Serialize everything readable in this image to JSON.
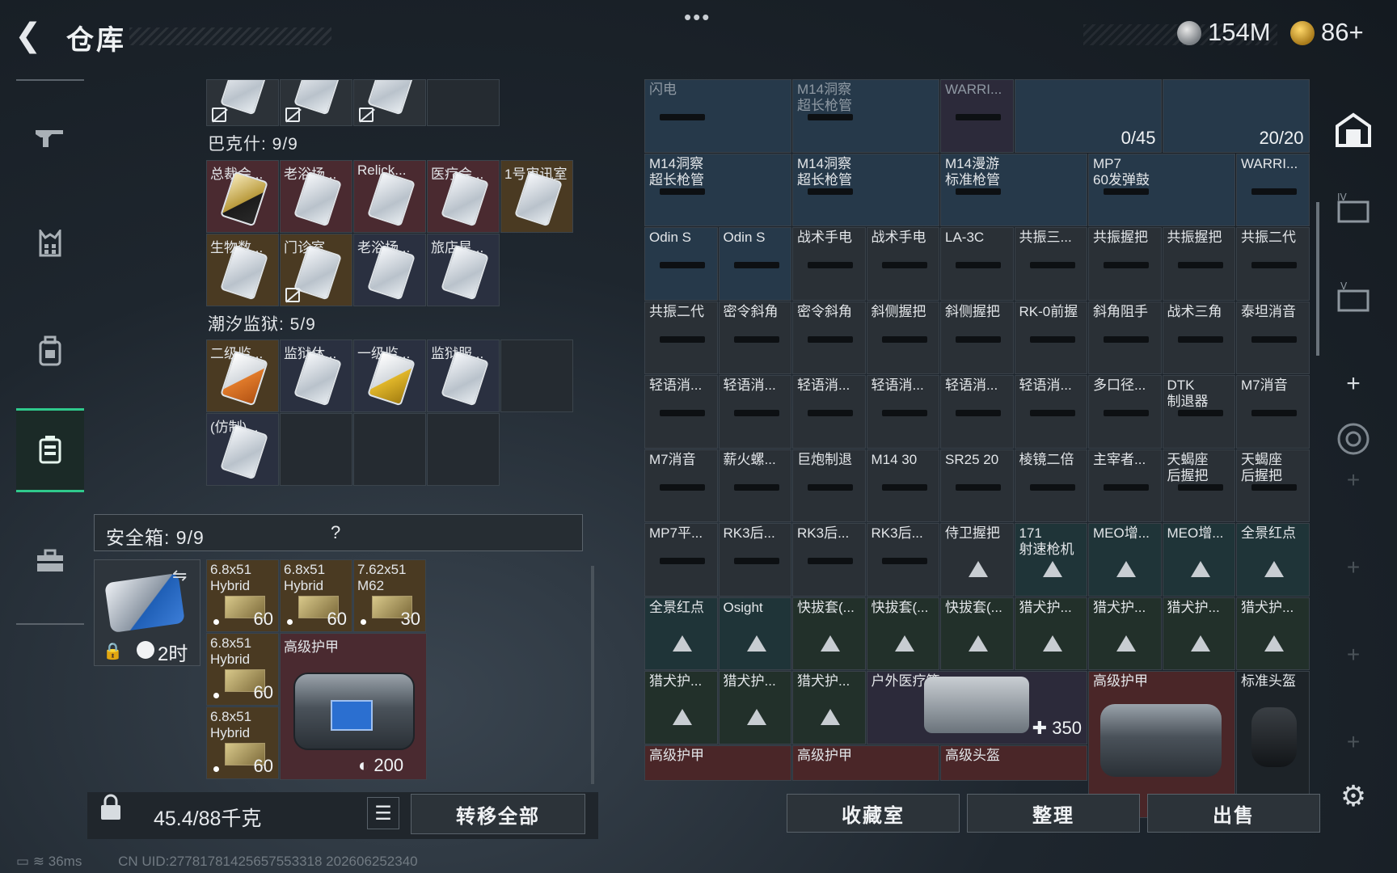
{
  "header": {
    "title": "仓库",
    "more": "•••",
    "currency_silver": "154M",
    "currency_gold": "86+"
  },
  "left": {
    "section_baker": "巴克什: 9/9",
    "section_tide": "潮汐监狱: 5/9",
    "baker_items": [
      {
        "label": "总裁会..."
      },
      {
        "label": "老浴场..."
      },
      {
        "label": "Relick..."
      },
      {
        "label": "医疗会..."
      },
      {
        "label": "1号审讯室"
      },
      {
        "label": "生物数..."
      },
      {
        "label": "门诊室"
      },
      {
        "label": "老浴场..."
      },
      {
        "label": "旅店星..."
      }
    ],
    "tide_items": [
      {
        "label": "二级监..."
      },
      {
        "label": "监狱休..."
      },
      {
        "label": "一级监..."
      },
      {
        "label": "监狱服..."
      },
      {
        "label": "(仿制)..."
      }
    ],
    "safe_title": "安全箱: 9/9",
    "safe_help": "?",
    "safe_time": "2时",
    "ammo": [
      {
        "label": "6.8x51\nHybrid",
        "count": "60"
      },
      {
        "label": "6.8x51\nHybrid",
        "count": "60"
      },
      {
        "label": "7.62x51\nM62",
        "count": "30"
      },
      {
        "label": "6.8x51\nHybrid",
        "count": "60"
      },
      {
        "label": "6.8x51\nHybrid",
        "count": "60"
      }
    ],
    "armor_label": "高级护甲",
    "armor_value": "200",
    "weight": "45.4/88千克",
    "transfer_all": "转移全部"
  },
  "right": {
    "rows": [
      [
        {
          "l": "闪电",
          "d": true
        },
        {
          "l": "M14洞察\n超长枪管",
          "d": true
        },
        {
          "l": "WARRI...",
          "d": true
        },
        {
          "l": "",
          "c": "0/45"
        },
        {
          "l": "",
          "c": "20/20"
        }
      ],
      [
        {
          "l": "M14洞察\n超长枪管"
        },
        {
          "l": "M14洞察\n超长枪管"
        },
        {
          "l": "M14漫游\n标准枪管"
        },
        {
          "l": "MP7\n60发弹鼓"
        },
        {
          "l": "WARRI..."
        }
      ],
      [
        {
          "l": "Odin S"
        },
        {
          "l": "Odin S"
        },
        {
          "l": "战术手电"
        },
        {
          "l": "战术手电"
        },
        {
          "l": "LA-3C"
        },
        {
          "l": "共振三..."
        },
        {
          "l": "共振握把"
        },
        {
          "l": "共振握把"
        },
        {
          "l": "共振二代"
        }
      ],
      [
        {
          "l": "共振二代"
        },
        {
          "l": "密令斜角"
        },
        {
          "l": "密令斜角"
        },
        {
          "l": "斜侧握把"
        },
        {
          "l": "斜侧握把"
        },
        {
          "l": "RK-0前握"
        },
        {
          "l": "斜角阻手"
        },
        {
          "l": "战术三角"
        },
        {
          "l": "泰坦消音"
        }
      ],
      [
        {
          "l": "轻语消..."
        },
        {
          "l": "轻语消..."
        },
        {
          "l": "轻语消..."
        },
        {
          "l": "轻语消..."
        },
        {
          "l": "轻语消..."
        },
        {
          "l": "轻语消..."
        },
        {
          "l": "多口径..."
        },
        {
          "l": "DTK\n制退器"
        },
        {
          "l": "M7消音"
        }
      ],
      [
        {
          "l": "M7消音"
        },
        {
          "l": "薪火螺..."
        },
        {
          "l": "巨炮制退"
        },
        {
          "l": "M14 30"
        },
        {
          "l": "SR25 20"
        },
        {
          "l": "棱镜二倍"
        },
        {
          "l": "主宰者..."
        },
        {
          "l": "天蝎座\n后握把"
        },
        {
          "l": "天蝎座\n后握把"
        }
      ],
      [
        {
          "l": "MP7平..."
        },
        {
          "l": "RK3后..."
        },
        {
          "l": "RK3后..."
        },
        {
          "l": "RK3后..."
        },
        {
          "l": "侍卫握把"
        },
        {
          "l": "171\n射速枪机"
        },
        {
          "l": "MEO增..."
        },
        {
          "l": "MEO增..."
        },
        {
          "l": "全景红点"
        }
      ],
      [
        {
          "l": "全景红点"
        },
        {
          "l": "Osight"
        },
        {
          "l": "快拔套(..."
        },
        {
          "l": "快拔套(..."
        },
        {
          "l": "快拔套(..."
        },
        {
          "l": "猎犬护..."
        },
        {
          "l": "猎犬护..."
        },
        {
          "l": "猎犬护..."
        },
        {
          "l": "猎犬护..."
        }
      ],
      [
        {
          "l": "猎犬护..."
        },
        {
          "l": "猎犬护..."
        },
        {
          "l": "猎犬护..."
        },
        {
          "l": "户外医疗箱"
        },
        {
          "l": "高级护甲"
        },
        {
          "l": "标准头盔"
        }
      ]
    ],
    "med_value": "350",
    "bottom_labels": [
      "高级护甲",
      "高级护甲",
      "高级头盔"
    ],
    "btn_collection": "收藏室",
    "btn_sort": "整理",
    "btn_sell": "出售"
  },
  "footer": {
    "ping": "36ms",
    "uid": "CN UID:27781781425657553318 202606252340"
  }
}
